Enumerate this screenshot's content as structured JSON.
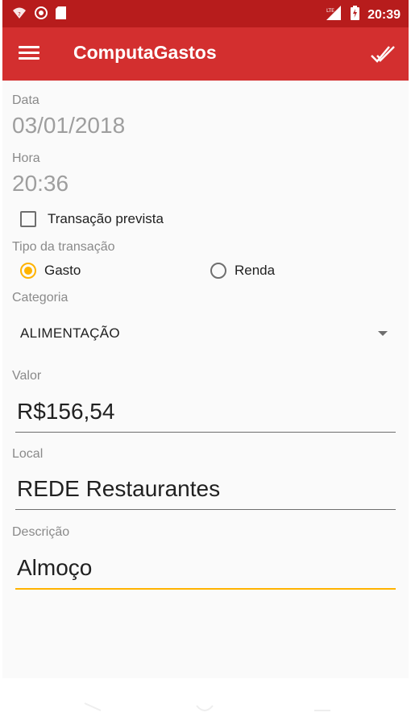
{
  "status_bar": {
    "time": "20:39",
    "icons": [
      "wifi-question-icon",
      "record-icon",
      "sd-card-icon",
      "signal-lte-icon",
      "battery-charging-icon"
    ]
  },
  "app_bar": {
    "title": "ComputaGastos",
    "menu_icon": "hamburger-menu-icon",
    "action_icon": "double-check-icon"
  },
  "form": {
    "date_label": "Data",
    "date_value": "03/01/2018",
    "time_label": "Hora",
    "time_value": "20:36",
    "planned_label": "Transação prevista",
    "planned_checked": false,
    "type_label": "Tipo da transação",
    "type_options": [
      {
        "label": "Gasto",
        "selected": true
      },
      {
        "label": "Renda",
        "selected": false
      }
    ],
    "category_label": "Categoria",
    "category_value": "ALIMENTAÇÃO",
    "value_label": "Valor",
    "value_value": "R$156,54",
    "place_label": "Local",
    "place_value": "REDE Restaurantes",
    "description_label": "Descrição",
    "description_value": "Almoço"
  },
  "colors": {
    "status_bar": "#b71c1c",
    "app_bar": "#d32f2f",
    "accent": "#ffb300",
    "background": "#fafafa"
  },
  "nav_bar": {
    "icons": [
      "back-icon",
      "home-icon",
      "recents-icon"
    ]
  }
}
